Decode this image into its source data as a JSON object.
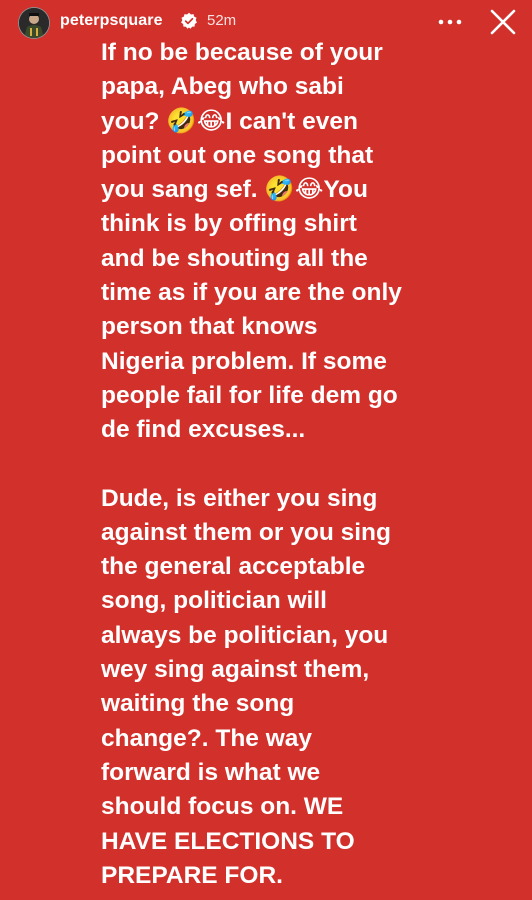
{
  "header": {
    "username": "peterpsquare",
    "time": "52m",
    "avatar_icon": "avatar-icon",
    "verified_icon": "verified-badge-icon",
    "more_icon": "more-options-icon",
    "close_icon": "close-icon"
  },
  "story": {
    "background_color": "#d2302b",
    "paragraph1": "If no be because of your\npapa, Abeg who sabi\nyou? 🤣😂I can't even\npoint out one song that\nyou sang sef. 🤣😂You\nthink is by offing shirt\nand be shouting all the\ntime as if you are the only\nperson that knows\nNigeria problem. If some\npeople fail for life dem go\nde find excuses...",
    "paragraph2": "Dude, is either you sing\nagainst them or you sing\nthe general acceptable\nsong, politician will\nalways be politician, you\nwey sing against them,\nwaiting the song\nchange?. The way\nforward is what we\nshould focus on. WE\nHAVE ELECTIONS TO\nPREPARE FOR."
  }
}
